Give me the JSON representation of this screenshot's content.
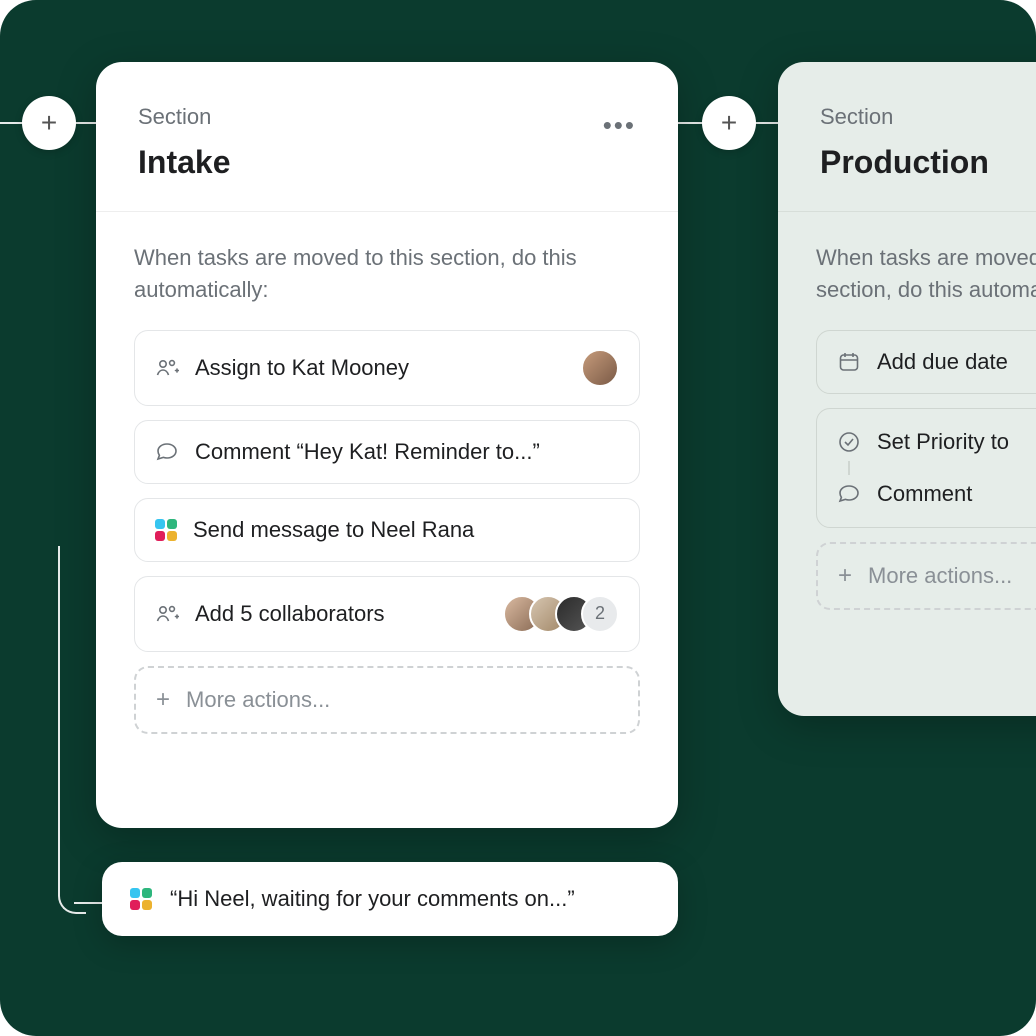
{
  "sections": {
    "intake": {
      "label": "Section",
      "title": "Intake",
      "prompt": "When tasks are moved to this section, do this automatically:",
      "rules": {
        "assign": "Assign to Kat Mooney",
        "comment": "Comment “Hey Kat! Reminder to...”",
        "slack": "Send message to Neel Rana",
        "collab": "Add 5 collaborators",
        "collab_more": "2",
        "more": "More actions..."
      }
    },
    "production": {
      "label": "Section",
      "title": "Production",
      "prompt": "When tasks are moved to this section, do this automatically:",
      "rules": {
        "duedate": "Add due date",
        "priority": "Set Priority to",
        "comment": "Comment",
        "more": "More actions..."
      }
    }
  },
  "slack_preview": "“Hi Neel, waiting for your comments on...”"
}
